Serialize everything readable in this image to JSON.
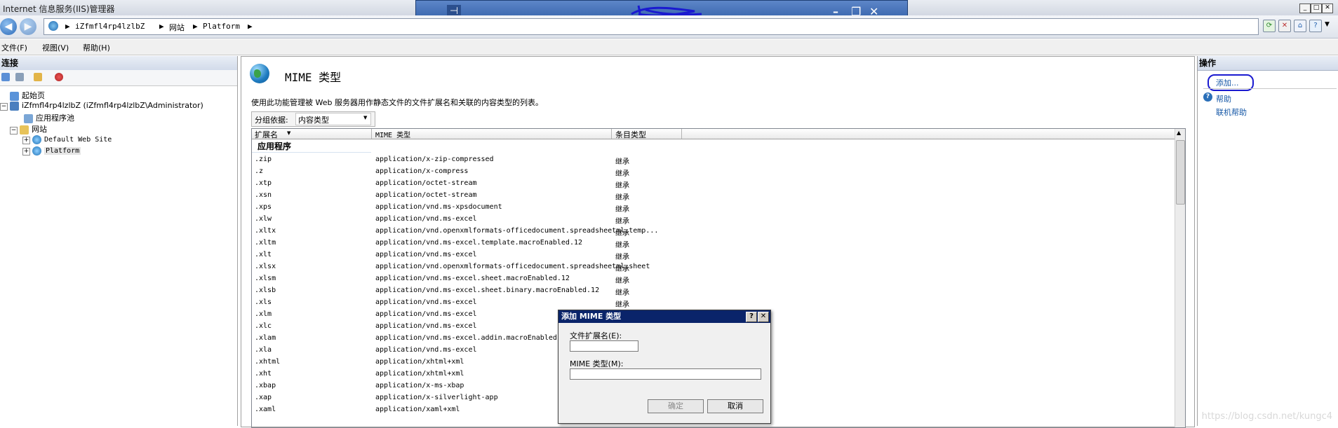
{
  "window": {
    "title": "Internet 信息服务(IIS)管理器"
  },
  "rdp": {
    "pin": "⊣"
  },
  "address": {
    "crumbs": [
      "iZfmfl4rp4lzlbZ",
      "网站",
      "Platform"
    ]
  },
  "menu": [
    "文件(F)",
    "视图(V)",
    "帮助(H)"
  ],
  "connections": {
    "header": "连接",
    "tree": [
      {
        "label": "起始页",
        "depth": 0
      },
      {
        "label": "iZfmfl4rp4lzlbZ (iZfmfl4rp4lzlbZ\\Administrator)",
        "depth": 0
      },
      {
        "label": "应用程序池",
        "depth": 1
      },
      {
        "label": "网站",
        "depth": 1
      },
      {
        "label": "Default Web Site",
        "depth": 2
      },
      {
        "label": "Platform",
        "depth": 2
      }
    ]
  },
  "main": {
    "title": "MIME 类型",
    "description": "使用此功能管理被 Web 服务器用作静态文件的文件扩展名和关联的内容类型的列表。",
    "group_by_label": "分组依据:",
    "group_by_value": "内容类型",
    "columns": [
      "扩展名",
      "MIME 类型",
      "条目类型"
    ],
    "group_name": "应用程序",
    "rows": [
      [
        ".zip",
        "application/x-zip-compressed",
        "继承"
      ],
      [
        ".z",
        "application/x-compress",
        "继承"
      ],
      [
        ".xtp",
        "application/octet-stream",
        "继承"
      ],
      [
        ".xsn",
        "application/octet-stream",
        "继承"
      ],
      [
        ".xps",
        "application/vnd.ms-xpsdocument",
        "继承"
      ],
      [
        ".xlw",
        "application/vnd.ms-excel",
        "继承"
      ],
      [
        ".xltx",
        "application/vnd.openxmlformats-officedocument.spreadsheetml.temp...",
        "继承"
      ],
      [
        ".xltm",
        "application/vnd.ms-excel.template.macroEnabled.12",
        "继承"
      ],
      [
        ".xlt",
        "application/vnd.ms-excel",
        "继承"
      ],
      [
        ".xlsx",
        "application/vnd.openxmlformats-officedocument.spreadsheetml.sheet",
        "继承"
      ],
      [
        ".xlsm",
        "application/vnd.ms-excel.sheet.macroEnabled.12",
        "继承"
      ],
      [
        ".xlsb",
        "application/vnd.ms-excel.sheet.binary.macroEnabled.12",
        "继承"
      ],
      [
        ".xls",
        "application/vnd.ms-excel",
        "继承"
      ],
      [
        ".xlm",
        "application/vnd.ms-excel",
        ""
      ],
      [
        ".xlc",
        "application/vnd.ms-excel",
        ""
      ],
      [
        ".xlam",
        "application/vnd.ms-excel.addin.macroEnabled.",
        ""
      ],
      [
        ".xla",
        "application/vnd.ms-excel",
        ""
      ],
      [
        ".xhtml",
        "application/xhtml+xml",
        ""
      ],
      [
        ".xht",
        "application/xhtml+xml",
        ""
      ],
      [
        ".xbap",
        "application/x-ms-xbap",
        ""
      ],
      [
        ".xap",
        "application/x-silverlight-app",
        ""
      ],
      [
        ".xaml",
        "application/xaml+xml",
        ""
      ]
    ]
  },
  "actions": {
    "header": "操作",
    "add": "添加...",
    "help": "帮助",
    "online_help": "联机帮助"
  },
  "dialog": {
    "title": "添加 MIME 类型",
    "ext_label": "文件扩展名(E):",
    "ext_value": "",
    "mime_label": "MIME 类型(M):",
    "mime_value": "",
    "ok": "确定",
    "cancel": "取消",
    "help_btn": "?",
    "close_btn": "✕"
  },
  "watermark": "https://blog.csdn.net/kungc4"
}
